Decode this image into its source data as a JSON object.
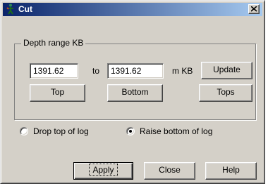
{
  "window": {
    "title": "Cut"
  },
  "depth_range": {
    "group_label": "Depth range KB",
    "from_value": "1391.62",
    "to_label": "to",
    "to_value": "1391.62",
    "unit_label": "m KB",
    "update_button": "Update",
    "top_button": "Top",
    "bottom_button": "Bottom",
    "tops_button": "Tops"
  },
  "options": {
    "drop_top_label": "Drop top of log",
    "drop_top_selected": false,
    "raise_bottom_label": "Raise bottom of log",
    "raise_bottom_selected": true
  },
  "buttons": {
    "apply": "Apply",
    "close": "Close",
    "help": "Help"
  },
  "colors": {
    "title_start": "#0a246a",
    "title_end": "#a6caf0",
    "face": "#d4d0c8"
  }
}
